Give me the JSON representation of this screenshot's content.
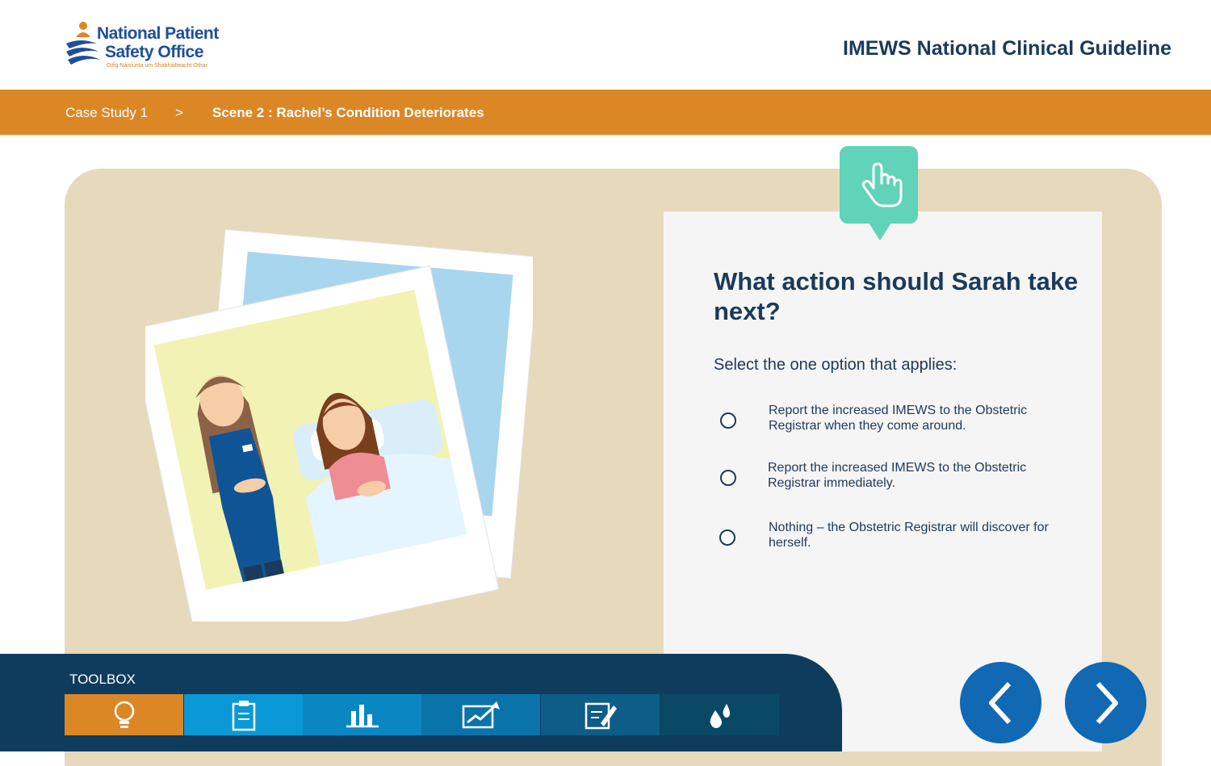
{
  "header": {
    "logo_line1": "National Patient",
    "logo_line2": "Safety Office",
    "logo_tagline": "Oifig Náisiúnta um Shábháilteacht Othar",
    "app_title": "IMEWS National Clinical Guideline"
  },
  "breadcrumb": {
    "case": "Case Study 1",
    "separator": ">",
    "scene": "Scene 2 : Rachel’s Condition Deteriorates"
  },
  "question": {
    "title": "What action should Sarah take next?",
    "instruction": "Select the one option that applies:",
    "options": [
      {
        "label": "Report the increased IMEWS to the Obstetric Registrar when they come around.",
        "selected": false
      },
      {
        "label": "Report the increased IMEWS to the Obstetric Registrar immediately.",
        "selected": false
      },
      {
        "label": "Nothing – the Obstetric Registrar will discover for herself.",
        "selected": false
      }
    ]
  },
  "toolbox": {
    "label": "TOOLBOX",
    "tools": [
      {
        "icon": "lightbulb-icon",
        "color": "#dc8726"
      },
      {
        "icon": "clipboard-icon",
        "color": "#0a99d6"
      },
      {
        "icon": "bar-chart-icon",
        "color": "#0a87c3"
      },
      {
        "icon": "trend-chart-icon",
        "color": "#0a74aa"
      },
      {
        "icon": "notepad-pencil-icon",
        "color": "#0e5c88"
      },
      {
        "icon": "droplets-icon",
        "color": "#0a4966"
      }
    ]
  },
  "navigation": {
    "prev_icon": "chevron-left-icon",
    "next_icon": "chevron-right-icon"
  },
  "colors": {
    "brand_orange": "#dc8726",
    "navy": "#1b3a5c",
    "stage_beige": "#e7d9bb",
    "accent_teal": "#60d3b8",
    "nav_blue": "#1168b3",
    "toolbox_bg": "#0f3c5d"
  }
}
